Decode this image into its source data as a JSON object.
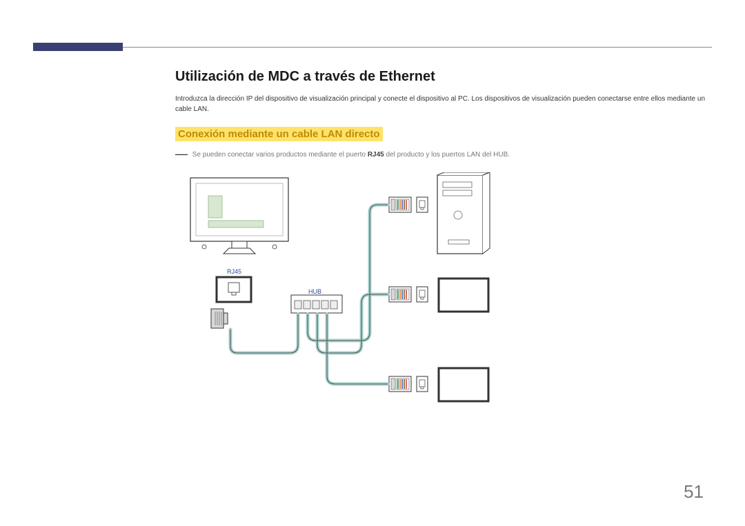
{
  "heading": "Utilización de MDC a través de Ethernet",
  "intro": "Introduzca la dirección IP del dispositivo de visualización principal y conecte el dispositivo al PC. Los dispositivos de visualización pueden conectarse entre ellos mediante un cable LAN.",
  "subheading": "Conexión mediante un cable LAN directo",
  "note_prefix": "―",
  "note_before_bold": " Se pueden conectar varios productos mediante el puerto ",
  "note_bold": "RJ45",
  "note_after_bold": " del producto y los puertos LAN del HUB.",
  "labels": {
    "rj45": "RJ45",
    "hub": "HUB"
  },
  "page_number": "51"
}
